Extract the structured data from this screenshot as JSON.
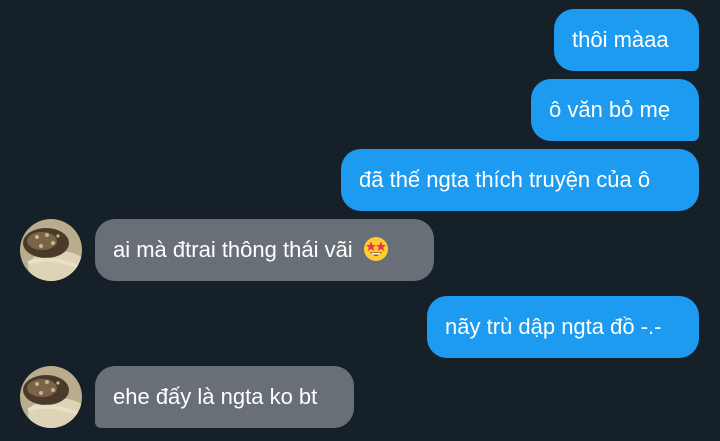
{
  "conversation": {
    "messages": [
      {
        "from": "me",
        "text": "thôi màaa"
      },
      {
        "from": "me",
        "text": "ô văn bỏ mẹ"
      },
      {
        "from": "me",
        "text": "đã thế ngta thích truyện của ô"
      },
      {
        "from": "them",
        "text": "ai mà đtrai thông thái vãi",
        "emoji": "star-struck-emoji"
      },
      {
        "from": "me",
        "text": "nãy trù dập ngta đồ -.-"
      },
      {
        "from": "them",
        "text": "ehe đấy là ngta ko bt"
      }
    ]
  },
  "colors": {
    "background": "#162029",
    "sent_bubble": "#1d9bf0",
    "received_bubble": "#686f77",
    "text": "#ffffff"
  }
}
